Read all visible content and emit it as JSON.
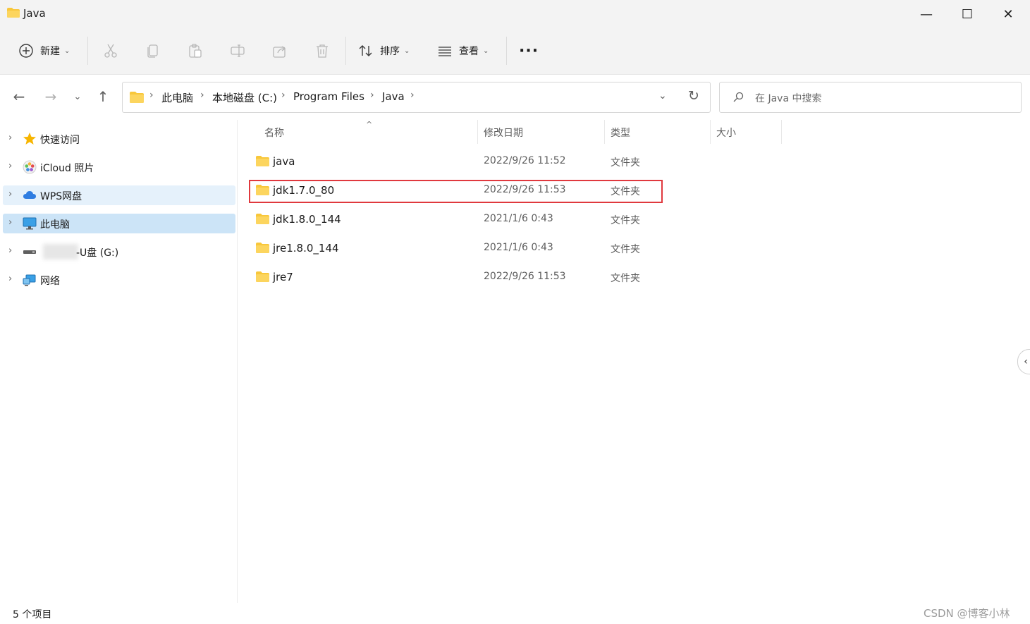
{
  "window": {
    "title": "Java",
    "minimize_glyph": "—",
    "maximize_glyph": "☐",
    "close_glyph": "✕"
  },
  "toolbar": {
    "new_label": "新建",
    "sort_label": "排序",
    "view_label": "查看",
    "more_label": "···",
    "icons": [
      "add-circle-icon",
      "cut-icon",
      "copy-icon",
      "paste-icon",
      "rename-icon",
      "share-icon",
      "delete-icon",
      "sort-icon",
      "view-icon",
      "more-icon"
    ]
  },
  "address": {
    "crumbs": [
      "此电脑",
      "本地磁盘 (C:)",
      "Program Files",
      "Java"
    ],
    "search_placeholder": "在 Java 中搜索"
  },
  "nav": {
    "items": [
      {
        "label": "快速访问",
        "icon": "star-icon"
      },
      {
        "label": "iCloud 照片",
        "icon": "icloud-photos-icon"
      },
      {
        "label": "WPS网盘",
        "icon": "cloud-icon"
      },
      {
        "label": "此电脑",
        "icon": "computer-icon"
      },
      {
        "label": "-U盘 (G:)",
        "icon": "usb-drive-icon"
      },
      {
        "label": "网络",
        "icon": "network-icon"
      }
    ]
  },
  "columns": {
    "name": "名称",
    "modified": "修改日期",
    "type": "类型",
    "size": "大小"
  },
  "files": [
    {
      "name": "java",
      "modified": "2022/9/26 11:52",
      "type": "文件夹"
    },
    {
      "name": "jdk1.7.0_80",
      "modified": "2022/9/26 11:53",
      "type": "文件夹"
    },
    {
      "name": "jdk1.8.0_144",
      "modified": "2021/1/6 0:43",
      "type": "文件夹"
    },
    {
      "name": "jre1.8.0_144",
      "modified": "2021/1/6 0:43",
      "type": "文件夹"
    },
    {
      "name": "jre7",
      "modified": "2022/9/26 11:53",
      "type": "文件夹"
    }
  ],
  "status": {
    "item_count": "5 个项目"
  },
  "watermark": "CSDN @博客小林",
  "colors": {
    "highlight_border": "#e0393e",
    "folder_yellow": "#f8c73b",
    "selected_nav": "#cce4f7",
    "hover_nav": "#e5f1fb"
  }
}
